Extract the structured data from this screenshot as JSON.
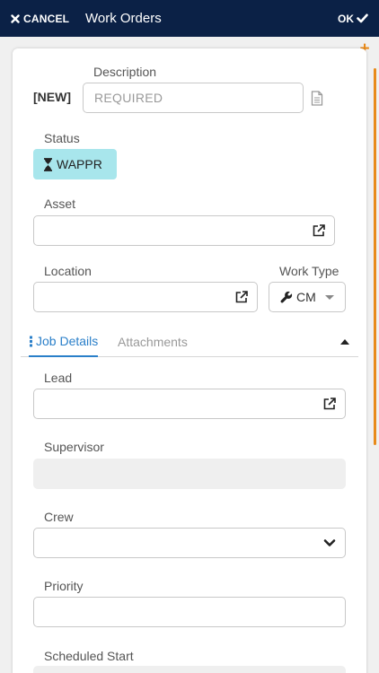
{
  "header": {
    "cancel_label": "CANCEL",
    "title": "Work Orders",
    "ok_label": "OK"
  },
  "form": {
    "new_tag": "[NEW]",
    "description_label": "Description",
    "description_placeholder": "REQUIRED",
    "status_label": "Status",
    "status_value": "WAPPR",
    "asset_label": "Asset",
    "location_label": "Location",
    "worktype_label": "Work Type",
    "worktype_value": "CM"
  },
  "tabs": [
    {
      "label": "Job Details",
      "active": true
    },
    {
      "label": "Attachments",
      "active": false
    }
  ],
  "job_details": {
    "lead_label": "Lead",
    "supervisor_label": "Supervisor",
    "crew_label": "Crew",
    "priority_label": "Priority",
    "scheduled_start_label": "Scheduled Start"
  },
  "colors": {
    "header_bg": "#0b2146",
    "accent_orange": "#e88a1a",
    "status_badge_bg": "#a8e6ec",
    "tab_active": "#2a7fc9"
  },
  "icons": {
    "cancel": "close-icon",
    "ok": "checkmark-icon",
    "add": "plus-icon",
    "document": "document-icon",
    "status": "hourglass-icon",
    "lookup": "external-link-icon",
    "worktype": "wrench-icon",
    "tab_job_details": "vertical-ellipsis-icon",
    "collapse": "caret-up-icon",
    "crew_select": "chevron-down-icon"
  }
}
